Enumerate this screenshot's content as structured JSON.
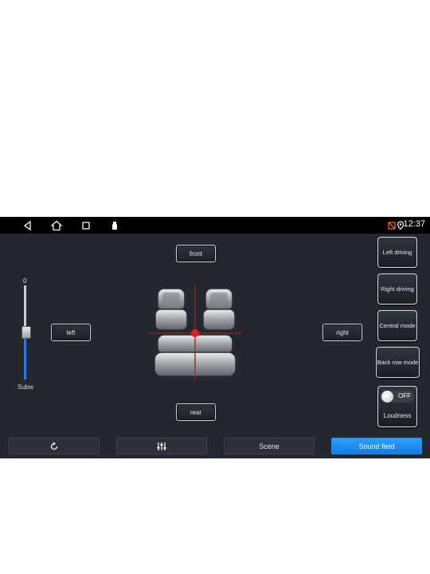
{
  "statusbar": {
    "time": "12:37"
  },
  "direction": {
    "front": "front",
    "rear": "rear",
    "left": "left",
    "right": "right"
  },
  "subwoofer": {
    "value": "0",
    "label": "Subw",
    "level_fraction": 0.45
  },
  "modes": [
    {
      "label": "Left driving"
    },
    {
      "label": "Right driving"
    },
    {
      "label": "Central mode"
    },
    {
      "label": "Back row mode"
    }
  ],
  "loudness": {
    "state": "OFF",
    "label": "Loudness"
  },
  "bottom_tabs": {
    "scene": "Scene",
    "sound_field": "Sound field"
  },
  "colors": {
    "accent": "#1e7cf0",
    "background": "#23282e",
    "focus_point": "#e02020"
  }
}
